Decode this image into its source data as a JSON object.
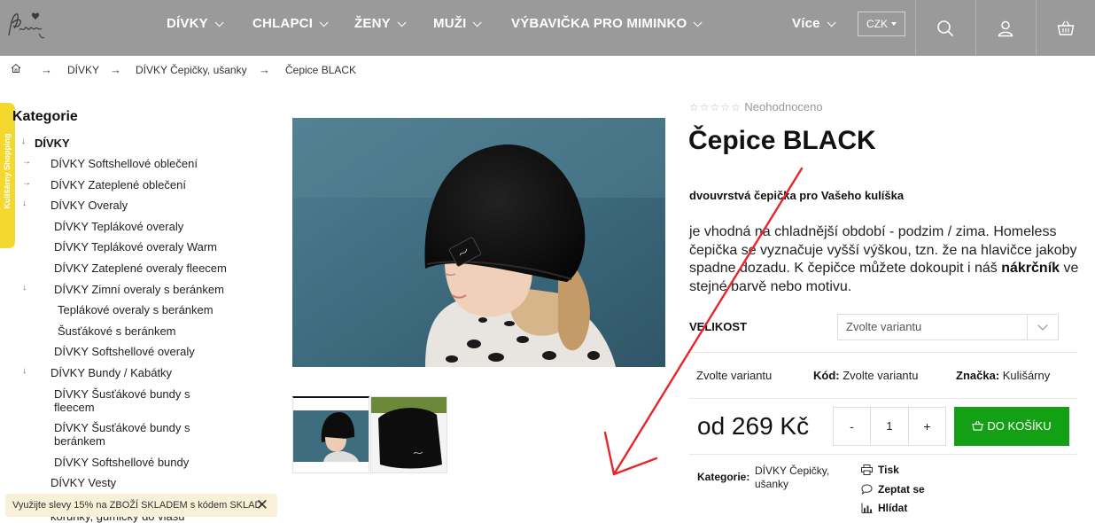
{
  "header": {
    "nav": [
      {
        "label": "DÍVKY"
      },
      {
        "label": "CHLAPCI"
      },
      {
        "label": "ŽENY"
      },
      {
        "label": "MUŽI"
      },
      {
        "label": "VÝBAVIČKA PRO MIMINKO"
      },
      {
        "label": "Více"
      }
    ],
    "currency": "CZK",
    "icons": [
      "search-icon",
      "user-icon",
      "cart-icon"
    ]
  },
  "breadcrumb": {
    "items": [
      {
        "label": "DÍVKY"
      },
      {
        "label": "DÍVKY Čepičky, ušanky"
      },
      {
        "label": "Čepice BLACK"
      }
    ]
  },
  "side_tab": {
    "label": "Kulišárny Shopping"
  },
  "sidebar": {
    "title": "Kategorie",
    "items": [
      {
        "label": "DÍVKY"
      },
      {
        "label": "DÍVKY Softshellové oblečení"
      },
      {
        "label": "DÍVKY Zateplené oblečení"
      },
      {
        "label": "DÍVKY Overaly"
      },
      {
        "label": "DÍVKY Teplákové overaly"
      },
      {
        "label": "DÍVKY Teplákové overaly Warm"
      },
      {
        "label": "DÍVKY Zateplené overaly fleecem"
      },
      {
        "label": "DÍVKY Zimní overaly s beránkem"
      },
      {
        "label": "Teplákové overaly s beránkem"
      },
      {
        "label": "Šusťákové s beránkem"
      },
      {
        "label": "DÍVKY Softshellové overaly"
      },
      {
        "label": "DÍVKY Bundy / Kabátky"
      },
      {
        "label": "DÍVKY Šusťákové bundy s fleecem"
      },
      {
        "label": "DÍVKY Šusťákové bundy s beránkem"
      },
      {
        "label": "DÍVKY Softshellové bundy"
      },
      {
        "label": "DÍVKY Vesty"
      },
      {
        "label": "korunky, gumičky do vlasů"
      }
    ]
  },
  "promo": {
    "text": "Využijte slevy 15% na ZBOŽÍ SKLADEM s kódem SKLAD"
  },
  "product": {
    "rating_text": "Neohodnoceno",
    "title": "Čepice BLACK",
    "subtitle": "dvouvrstvá čepička pro Vašeho kulíška",
    "description_parts": [
      "je vhodná na chladnější období - podzim / zima. Homeless čepička se vyznačuje vyšší výškou, tzn. že na hlavičce jakoby spadne dozadu. K čepičce můžete dokoupit i náš ",
      "nákrčník",
      " ve stejné barvě nebo motivu."
    ],
    "variant_label": "VELIKOST",
    "variant_placeholder": "Zvolte variantu",
    "availability": "Zvolte variantu",
    "code_label": "Kód:",
    "code_value": "Zvolte variantu",
    "brand_label": "Značka:",
    "brand_value": "Kulišárny",
    "price": "od 269 Kč",
    "qty_minus": "-",
    "quantity": "1",
    "qty_plus": "+",
    "buy_label": "DO KOŠÍKU",
    "category_label": "Kategorie:",
    "category_value": "DÍVKY Čepičky, ušanky",
    "actions": [
      {
        "label": "Tisk",
        "icon": "print-icon"
      },
      {
        "label": "Zeptat se",
        "icon": "chat-icon"
      },
      {
        "label": "Hlídat",
        "icon": "chart-icon"
      }
    ]
  },
  "colors": {
    "header_bg": "#9a9a9a",
    "buy_button": "#14a014",
    "side_tab": "#f5d82e",
    "annotation_arrow": "#e8252b"
  }
}
